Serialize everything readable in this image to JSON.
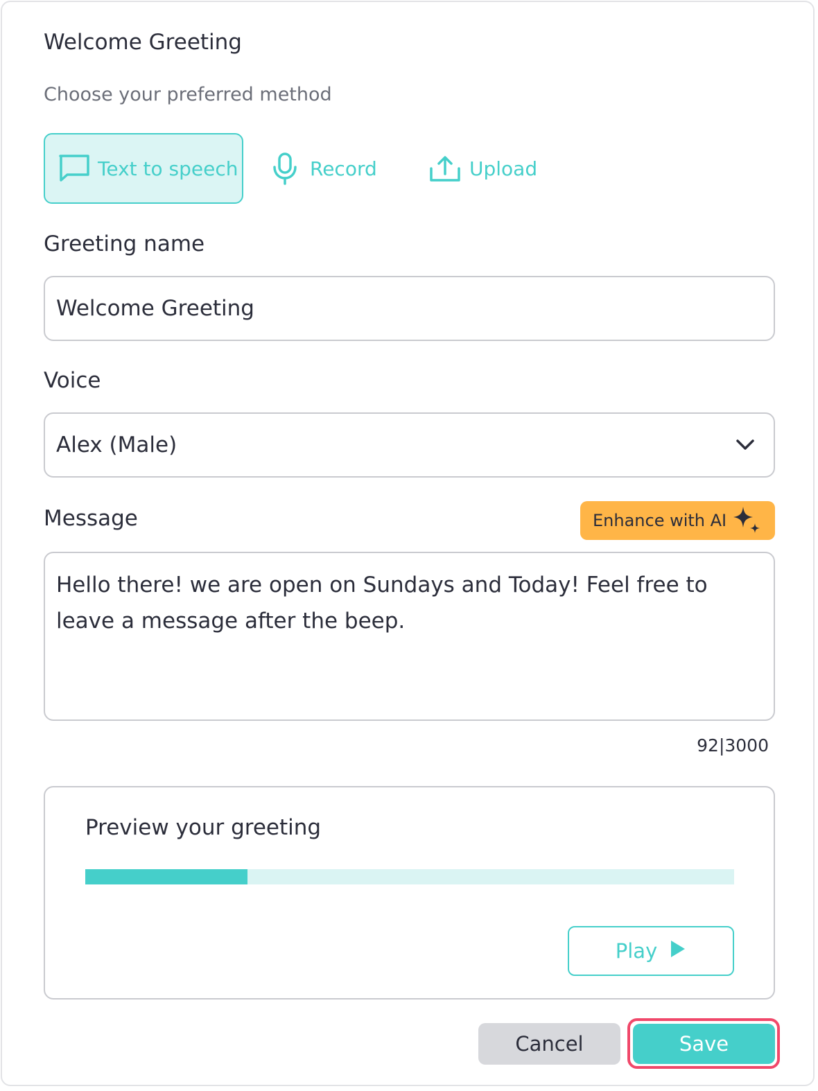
{
  "dialog": {
    "title": "Welcome Greeting",
    "subtitle": "Choose your preferred method"
  },
  "methods": {
    "tts_label": "Text to speech",
    "record_label": "Record",
    "upload_label": "Upload",
    "selected": "Text to speech"
  },
  "greeting_name": {
    "label": "Greeting name",
    "value": "Welcome Greeting"
  },
  "voice": {
    "label": "Voice",
    "selected": "Alex (Male)"
  },
  "message": {
    "label": "Message",
    "enhance_label": "Enhance with AI",
    "value": "Hello there! we are open on Sundays and Today! Feel free to leave a message after the beep.",
    "counter": "92|3000"
  },
  "preview": {
    "title": "Preview your greeting",
    "progress": 0.25,
    "play_label": "Play"
  },
  "actions": {
    "cancel_label": "Cancel",
    "save_label": "Save"
  },
  "colors": {
    "accent": "#45cfca",
    "accent_light": "#dbf5f4",
    "ai_button": "#ffb547",
    "save_highlight": "#f0486a",
    "text": "#2b2d3a"
  },
  "icons": {
    "tts": "chat-bubble-icon",
    "record": "microphone-icon",
    "upload": "upload-icon",
    "voice_dropdown": "chevron-down-icon",
    "enhance": "sparkles-icon",
    "play": "play-icon"
  }
}
